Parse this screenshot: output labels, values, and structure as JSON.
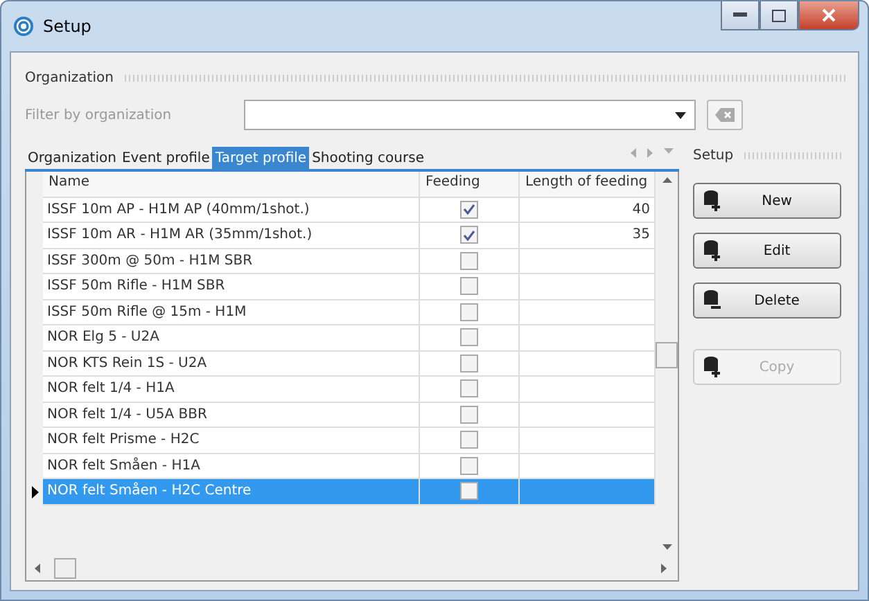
{
  "window": {
    "title": "Setup"
  },
  "organization": {
    "title": "Organization",
    "filter_label": "Filter by organization"
  },
  "tabs": [
    {
      "label": "Organization",
      "selected": false
    },
    {
      "label": "Event profile",
      "selected": false
    },
    {
      "label": "Target profile",
      "selected": true
    },
    {
      "label": "Shooting course",
      "selected": false
    }
  ],
  "table": {
    "columns": [
      "Name",
      "Feeding",
      "Length of feeding"
    ],
    "rows": [
      {
        "name": "ISSF 10m AP - H1M AP (40mm/1shot.)",
        "feeding": true,
        "length": "40",
        "selected": false
      },
      {
        "name": "ISSF 10m AR - H1M AR (35mm/1shot.)",
        "feeding": true,
        "length": "35",
        "selected": false
      },
      {
        "name": "ISSF 300m @ 50m - H1M SBR",
        "feeding": false,
        "selected": false
      },
      {
        "name": "ISSF 50m Rifle - H1M SBR",
        "feeding": false,
        "selected": false
      },
      {
        "name": "ISSF 50m Rifle @ 15m - H1M",
        "feeding": false,
        "selected": false
      },
      {
        "name": "NOR Elg 5 - U2A",
        "feeding": false,
        "selected": false
      },
      {
        "name": "NOR KTS Rein 1S - U2A",
        "feeding": false,
        "selected": false
      },
      {
        "name": "NOR felt 1/4 - H1A",
        "feeding": false,
        "selected": false
      },
      {
        "name": "NOR felt 1/4 - U5A BBR",
        "feeding": false,
        "selected": false
      },
      {
        "name": "NOR felt Prisme - H2C",
        "feeding": false,
        "selected": false
      },
      {
        "name": "NOR felt Småen - H1A",
        "feeding": false,
        "selected": false
      },
      {
        "name": "NOR felt Småen - H2C Centre",
        "feeding": false,
        "selected": true
      }
    ]
  },
  "setup": {
    "title": "Setup",
    "buttons": [
      {
        "label": "New",
        "kind": "new",
        "disabled": false
      },
      {
        "label": "Edit",
        "kind": "edit",
        "disabled": false
      },
      {
        "label": "Delete",
        "kind": "delete",
        "disabled": false
      },
      {
        "label": "Copy",
        "kind": "copy",
        "disabled": true
      }
    ]
  }
}
